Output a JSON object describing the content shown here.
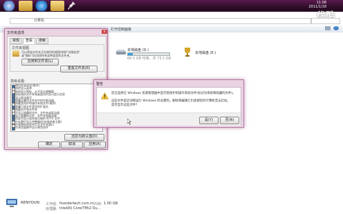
{
  "taskbar": {
    "time": "11:08",
    "date": "2011/1/18",
    "watermark": "优酷"
  },
  "explorer": {
    "address": "计算机",
    "toolbar_items": [
      "组织",
      "系统属性",
      "卸载或更改程序",
      "映射网络驱动器",
      "打开控制面板"
    ]
  },
  "drives": [
    {
      "name": "本地磁盘 (D:)",
      "info": "66.5 GB 可用，共 73.1 GB",
      "fill": 0.12
    },
    {
      "name": "本地磁盘 (E:)",
      "info": "",
      "fill": 0
    }
  ],
  "folder_options": {
    "title": "文件夹选项",
    "close": "x",
    "tabs": [
      "常规",
      "查看",
      "搜索"
    ],
    "section_title": "文件夹视图",
    "desc1": "可以将该文件夹正在使用的视图(例如\"详细信息\"",
    "desc2": "或\"图标\")应用到所有这种类型的文件夹。",
    "apply_button": "应用到文件夹(L)",
    "reset_button": "重置文件夹(R)",
    "advanced_title": "高级设置:",
    "advanced_items": [
      {
        "label": "使用共享向导(推荐)",
        "checked": true
      },
      {
        "label": "始终显示菜单",
        "checked": false
      },
      {
        "label": "始终显示图标，从不显示缩略图",
        "checked": false
      },
      {
        "label": "鼠标指向文件夹和桌面项时显示提示信息",
        "checked": true
      },
      {
        "label": "显示驱动器号",
        "checked": true
      },
      {
        "label": "隐藏计算机文件夹中的空驱动器",
        "checked": true
      },
      {
        "label": "隐藏受保护的操作系统文件(推荐)",
        "checked": false
      },
      {
        "label": "隐藏已知文件类型的扩展名",
        "checked": true
      },
      {
        "label": "隐藏文件和文件夹",
        "checked": false
      },
      {
        "label": "不显示隐藏的文件、文件夹或驱动器",
        "checked": false
      },
      {
        "label": "显示隐藏的文件、文件夹和驱动器",
        "checked": true
      },
      {
        "label": "用彩色显示加密或压缩的 NTFS 文件",
        "checked": true
      },
      {
        "label": "在标题栏显示完整路径(仅限经典主题)",
        "checked": false
      },
      {
        "label": "在单独的进程中打开文件夹窗口",
        "checked": false
      },
      {
        "label": "在预览窗格中显示预览控件",
        "checked": true
      }
    ],
    "restore_button": "还原为默认值(D)",
    "ok_button": "确定",
    "cancel_button": "取消",
    "apply_bottom_button": "应用(A)"
  },
  "warning": {
    "title": "警告",
    "line1": "您已选择在 Windows 资源管理器中显示受保护的操作系统文件(标记为系统和隐藏的文件)。",
    "line2": "这些文件是启动和运行 Windows 所必需的。删除或编辑它们会使您的计算机无法启动。",
    "line3": "是否显示这些文件?",
    "yes_button": "是(Y)",
    "no_button": "否(N)"
  },
  "status": {
    "computer": "RENYOUN",
    "domain_label": "工作组:",
    "domain": "foundertech.com.cn",
    "memory_label": "内存:",
    "memory": "1.00 GB",
    "cpu_label": "处理器:",
    "cpu": "Intel(R) Core(TM)2 Du..."
  },
  "colors": {
    "taskbar": "#3a1233",
    "dialog_frame": "#ead3e3",
    "accent": "#3a6fb0"
  }
}
